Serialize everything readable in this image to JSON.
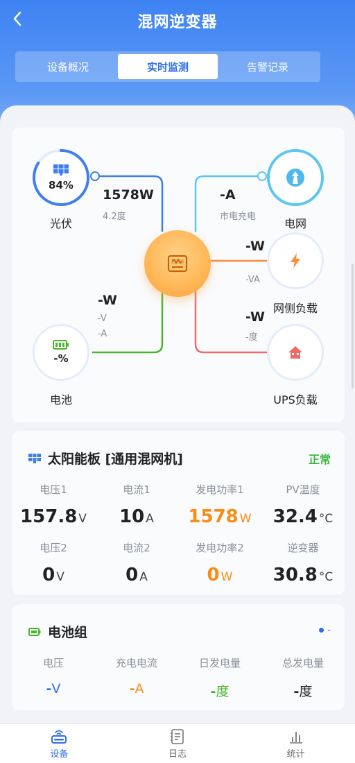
{
  "header": {
    "title": "混网逆变器"
  },
  "tabs": [
    {
      "label": "设备概况"
    },
    {
      "label": "实时监测"
    },
    {
      "label": "告警记录"
    }
  ],
  "flow": {
    "pv": {
      "label": "光伏",
      "percent": "84%",
      "power": "1578W",
      "energy": "4.2度"
    },
    "grid": {
      "label": "电网",
      "current": "-A",
      "note": "市电充电"
    },
    "grid_load": {
      "label": "网侧负载",
      "power": "-W",
      "apparent": "-VA"
    },
    "battery": {
      "label": "电池",
      "percent": "-%",
      "power": "-W",
      "voltage": "-V",
      "current": "-A"
    },
    "ups_load": {
      "label": "UPS负载",
      "power": "-W",
      "energy": "-度"
    }
  },
  "solar": {
    "title": "太阳能板 [通用混网机]",
    "status": "正常",
    "row1": [
      {
        "label": "电压1",
        "value": "157.8",
        "unit": "V"
      },
      {
        "label": "电流1",
        "value": "10",
        "unit": "A"
      },
      {
        "label": "发电功率1",
        "value": "1578",
        "unit": "W"
      },
      {
        "label": "PV温度",
        "value": "32.4",
        "unit": "°C"
      }
    ],
    "row2": [
      {
        "label": "电压2",
        "value": "0",
        "unit": "V"
      },
      {
        "label": "电流2",
        "value": "0",
        "unit": "A"
      },
      {
        "label": "发电功率2",
        "value": "0",
        "unit": "W"
      },
      {
        "label": "逆变器",
        "value": "30.8",
        "unit": "°C"
      }
    ]
  },
  "battery_group": {
    "title": "电池组",
    "indicator": "-",
    "items": [
      {
        "label": "电压",
        "value": "-",
        "unit": "V"
      },
      {
        "label": "充电电流",
        "value": "-",
        "unit": "A"
      },
      {
        "label": "日发电量",
        "value": "-",
        "unit": "度"
      },
      {
        "label": "总发电量",
        "value": "-",
        "unit": "度"
      }
    ]
  },
  "nav": [
    {
      "label": "设备"
    },
    {
      "label": "日志"
    },
    {
      "label": "统计"
    }
  ],
  "colors": {
    "primary": "#2f6fe6",
    "pv_line": "#3e7ef0",
    "grid_line": "#5cc6f2",
    "load_line": "#fa8c3c",
    "battery_line": "#49b52b",
    "ups_line": "#ee6b6b",
    "status_ok": "#3eb83e",
    "power_orange": "#fa8c16"
  }
}
